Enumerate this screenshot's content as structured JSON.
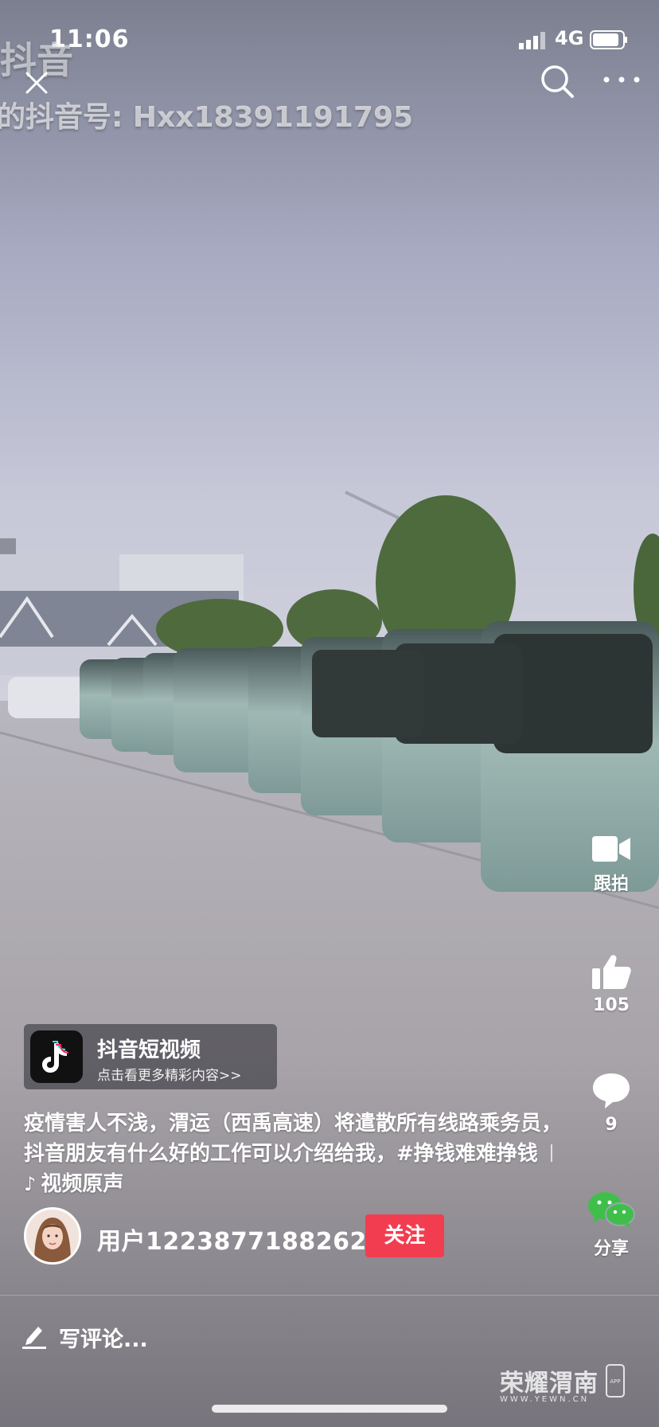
{
  "status_bar": {
    "time": "11:06",
    "network": "4G"
  },
  "watermark": {
    "logo_text": "抖音",
    "account_line": "的抖音号: Hxx18391191795"
  },
  "top_actions": {
    "close": "close-icon",
    "search": "search-icon",
    "more": "more-icon"
  },
  "side_actions": [
    {
      "icon": "video-camera-icon",
      "label": "跟拍"
    },
    {
      "icon": "thumbs-up-icon",
      "label": "105"
    },
    {
      "icon": "comment-icon",
      "label": "9"
    },
    {
      "icon": "wechat-icon",
      "label": "分享"
    }
  ],
  "app_card": {
    "name": "抖音短视频",
    "subtitle": "点击看更多精彩内容>>"
  },
  "caption": {
    "text": "疫情害人不浅，渭运（西禹高速）将遣散所有线路乘务员，抖音朋友有什么好的工作可以介绍给我，#挣钱难难挣钱",
    "music_label": "视频原声"
  },
  "user": {
    "name": "用户1223877188262",
    "follow_label": "关注"
  },
  "comment": {
    "placeholder": "写评论..."
  },
  "brand": {
    "name": "荣耀渭南",
    "url": "WWW.YEWN.CN",
    "phone_label": "APP"
  },
  "colors": {
    "follow": "#f23d50",
    "wechat": "#3fbf4a",
    "sky": "#a7aac1"
  }
}
